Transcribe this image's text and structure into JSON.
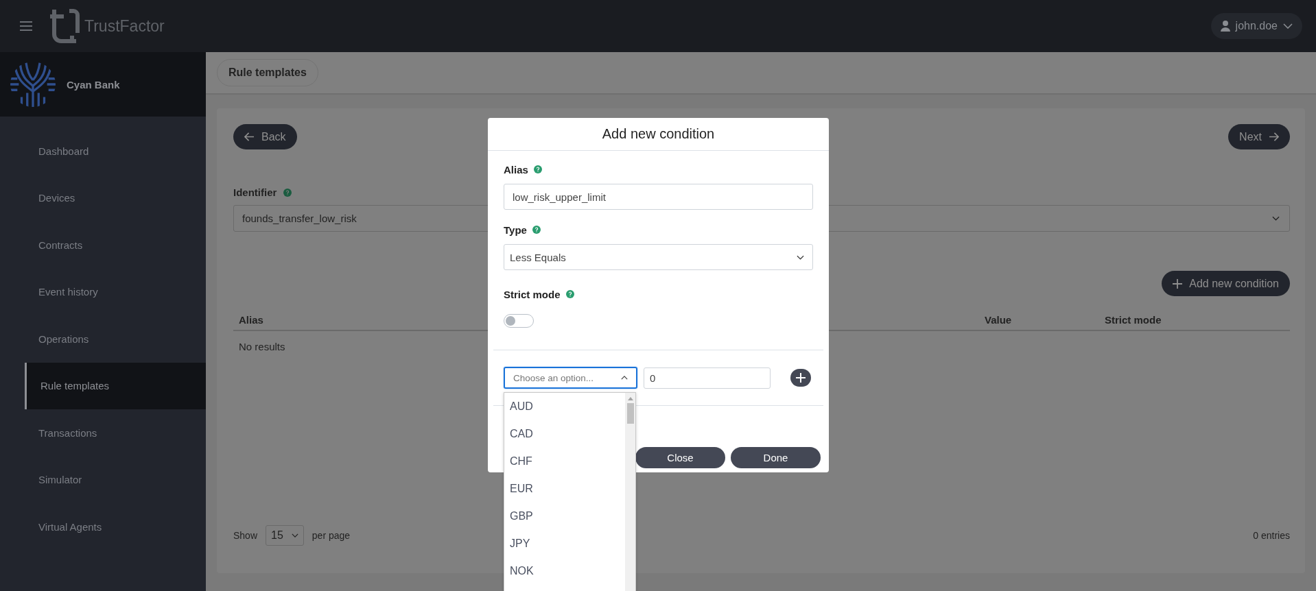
{
  "header": {
    "app_name": "TrustFactor",
    "user": "john.doe"
  },
  "sidebar": {
    "org_name": "Cyan Bank",
    "items": [
      {
        "label": "Dashboard",
        "selected": false
      },
      {
        "label": "Devices",
        "selected": false
      },
      {
        "label": "Contracts",
        "selected": false
      },
      {
        "label": "Event history",
        "selected": false
      },
      {
        "label": "Operations",
        "selected": false
      },
      {
        "label": "Rule templates",
        "selected": true
      },
      {
        "label": "Transactions",
        "selected": false
      },
      {
        "label": "Simulator",
        "selected": false
      },
      {
        "label": "Virtual Agents",
        "selected": false
      }
    ]
  },
  "breadcrumb": "Rule templates",
  "page": {
    "back_button": "Back",
    "next_button": "Next",
    "identifier_label": "Identifier",
    "identifier_value": "founds_transfer_low_risk",
    "add_button": "Add new condition",
    "table": {
      "columns": [
        "Alias",
        "Value",
        "Strict mode"
      ],
      "empty_text": "No results"
    },
    "footer": {
      "show_label": "Show",
      "page_size": "15",
      "per_page_label": "per page",
      "entries": "0 entries"
    }
  },
  "modal": {
    "title": "Add new condition",
    "alias_label": "Alias",
    "alias_value": "low_risk_upper_limit",
    "type_label": "Type",
    "type_value": "Less Equals",
    "strict_label": "Strict mode",
    "strict_mode": {
      "on": false
    },
    "currency_placeholder": "Choose an option...",
    "amount_value": "0",
    "currency_options": [
      "AUD",
      "CAD",
      "CHF",
      "EUR",
      "GBP",
      "JPY",
      "NOK"
    ],
    "buttons": [
      "Close",
      "Done"
    ]
  }
}
